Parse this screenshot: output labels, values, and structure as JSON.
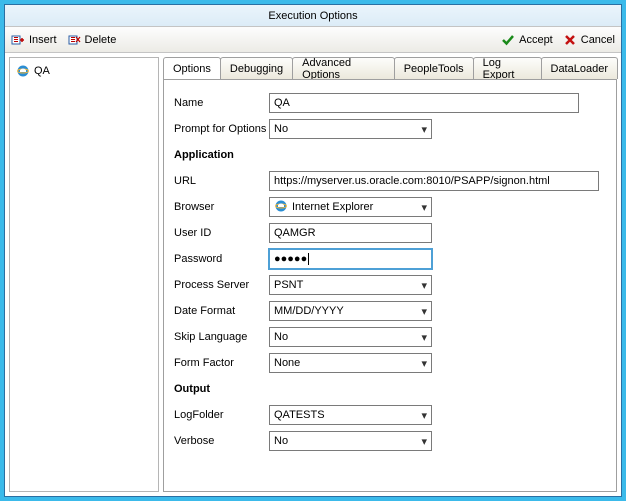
{
  "title": "Execution Options",
  "toolbar": {
    "insert": "Insert",
    "delete": "Delete",
    "accept": "Accept",
    "cancel": "Cancel"
  },
  "tree": {
    "item1": "QA"
  },
  "tabs": {
    "options": "Options",
    "debugging": "Debugging",
    "advanced": "Advanced Options",
    "peopletools": "PeopleTools",
    "logexport": "Log Export",
    "dataloader": "DataLoader"
  },
  "form": {
    "name_label": "Name",
    "name_value": "QA",
    "prompt_label": "Prompt for Options",
    "prompt_value": "No",
    "application_label": "Application",
    "url_label": "URL",
    "url_value": "https://myserver.us.oracle.com:8010/PSAPP/signon.html",
    "browser_label": "Browser",
    "browser_value": "Internet Explorer",
    "userid_label": "User ID",
    "userid_value": "QAMGR",
    "password_label": "Password",
    "password_value": "●●●●●",
    "process_label": "Process Server",
    "process_value": "PSNT",
    "date_label": "Date Format",
    "date_value": "MM/DD/YYYY",
    "skip_label": "Skip Language",
    "skip_value": "No",
    "form_label": "Form Factor",
    "form_value": "None",
    "output_label": "Output",
    "logfolder_label": "LogFolder",
    "logfolder_value": "QATESTS",
    "verbose_label": "Verbose",
    "verbose_value": "No"
  }
}
